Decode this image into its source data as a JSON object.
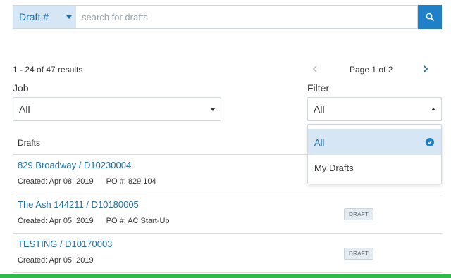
{
  "search": {
    "type_label": "Draft #",
    "placeholder": "search for drafts",
    "value": ""
  },
  "results": {
    "count_label": "1 - 24 of 47 results",
    "page_label": "Page 1 of 2"
  },
  "job": {
    "label": "Job",
    "selected": "All"
  },
  "filter": {
    "label": "Filter",
    "selected": "All",
    "options": [
      "All",
      "My Drafts"
    ]
  },
  "list": {
    "header": "Drafts",
    "rows": [
      {
        "title": "829 Broadway / D10230004",
        "created": "Created: Apr 08, 2019",
        "po": "PO #: 829 104",
        "badge": ""
      },
      {
        "title": "The Ash 144211 / D10180005",
        "created": "Created: Apr 05, 2019",
        "po": "PO #: AC Start-Up",
        "badge": "DRAFT"
      },
      {
        "title": "TESTING / D10170003",
        "created": "Created: Apr 05, 2019",
        "po": "",
        "badge": "DRAFT"
      }
    ]
  },
  "colors": {
    "accent": "#1f7fc7",
    "link": "#1f6fa8",
    "selected_bg": "#d6e6f5",
    "status_bar": "#2dbb4e"
  },
  "icons": {
    "search_button": "search-icon",
    "prev": "chevron-left-icon",
    "next": "chevron-right-icon",
    "selected_check": "check-circle-icon"
  }
}
